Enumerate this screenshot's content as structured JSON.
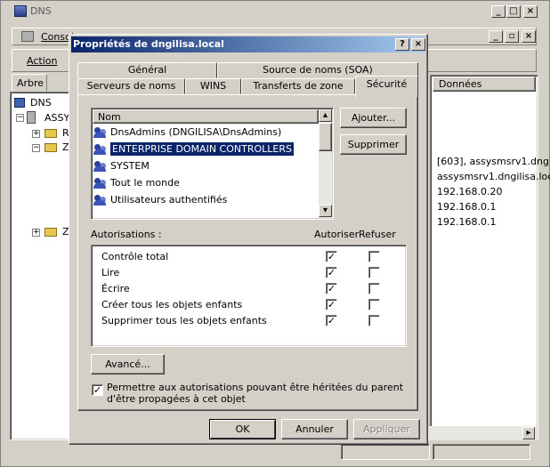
{
  "main_window": {
    "title": "DNS",
    "menu_console": "Consol",
    "menu_action": "Action",
    "tab_tree": "Arbre",
    "col_data": "Données",
    "tree_root": "DNS",
    "tree_server": "ASSY",
    "tree_items": [
      "R",
      "Z",
      "Z"
    ],
    "data_rows": [
      "[603], assysmsrv1.dng",
      "assysmsrv1.dngilisa.loc",
      "192.168.0.20",
      "192.168.0.1",
      "192.168.0.1"
    ]
  },
  "dialog": {
    "title": "Propriétés de dngilisa.local",
    "tabs_back": [
      "Général",
      "Source de noms (SOA)"
    ],
    "tabs_front": [
      "Serveurs de noms",
      "WINS",
      "Transferts de zone",
      "Sécurité"
    ],
    "users_header": "Nom",
    "users": [
      {
        "name": "DnsAdmins (DNGILISA\\DnsAdmins)",
        "selected": false
      },
      {
        "name": "ENTERPRISE DOMAIN CONTROLLERS",
        "selected": true
      },
      {
        "name": "SYSTEM",
        "selected": false
      },
      {
        "name": "Tout le monde",
        "selected": false
      },
      {
        "name": "Utilisateurs authentifiés",
        "selected": false
      }
    ],
    "add_button": "Ajouter...",
    "remove_button": "Supprimer",
    "permissions_label": "Autorisations :",
    "allow_header": "Autoriser",
    "deny_header": "Refuser",
    "permissions": [
      {
        "name": "Contrôle total",
        "allow": true,
        "deny": false
      },
      {
        "name": "Lire",
        "allow": true,
        "deny": false
      },
      {
        "name": "Écrire",
        "allow": true,
        "deny": false
      },
      {
        "name": "Créer tous les objets enfants",
        "allow": true,
        "deny": false
      },
      {
        "name": "Supprimer tous les objets enfants",
        "allow": true,
        "deny": false
      }
    ],
    "advanced_button": "Avancé...",
    "inherit_checked": true,
    "inherit_text_1": "Permettre aux autorisations pouvant être héritées du parent",
    "inherit_text_2": "d'être propagées à cet objet",
    "ok_button": "OK",
    "cancel_button": "Annuler",
    "apply_button": "Appliquer",
    "help_glyph": "?",
    "close_glyph": "×"
  }
}
